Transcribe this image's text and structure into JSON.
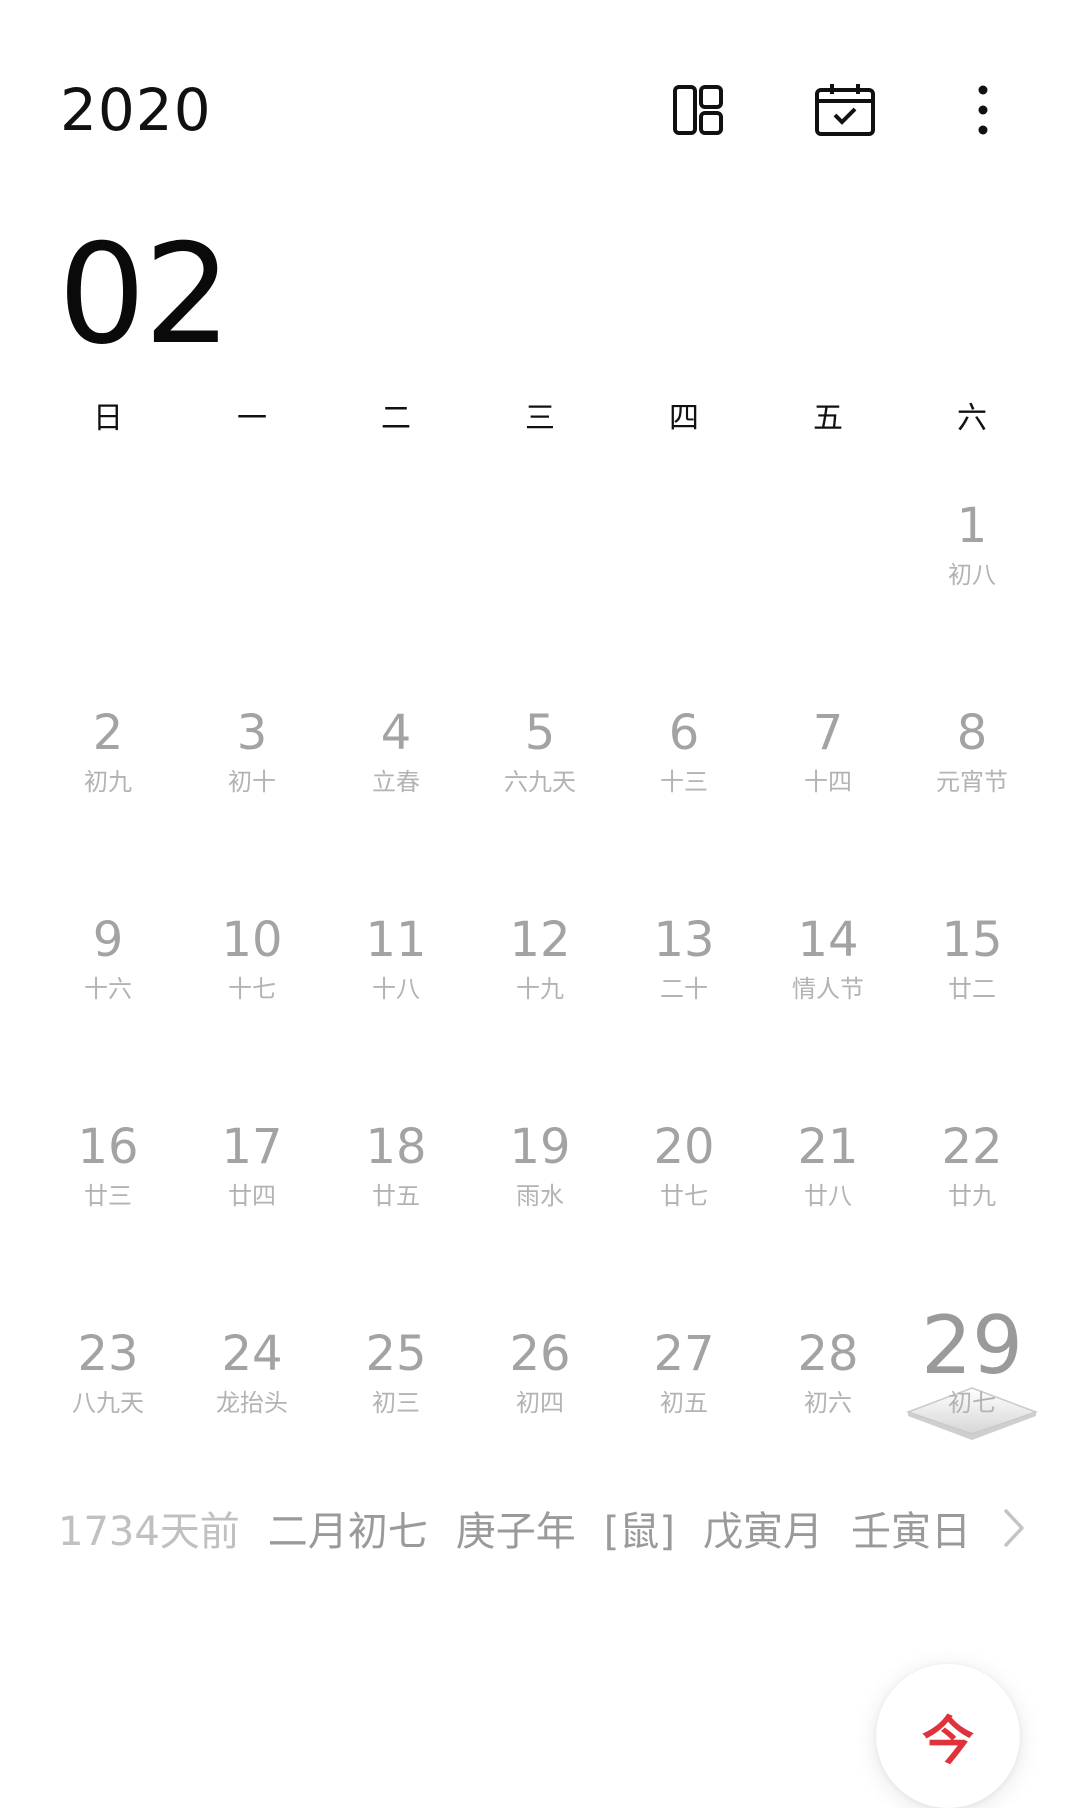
{
  "header": {
    "year": "2020",
    "month": "02",
    "icons": {
      "layout": "layout-panels-icon",
      "calendar": "calendar-check-icon",
      "more": "more-vertical-icon"
    }
  },
  "weekdays": [
    "日",
    "一",
    "二",
    "三",
    "四",
    "五",
    "六"
  ],
  "days": [
    {
      "day": "",
      "lunar": ""
    },
    {
      "day": "",
      "lunar": ""
    },
    {
      "day": "",
      "lunar": ""
    },
    {
      "day": "",
      "lunar": ""
    },
    {
      "day": "",
      "lunar": ""
    },
    {
      "day": "",
      "lunar": ""
    },
    {
      "day": "1",
      "lunar": "初八"
    },
    {
      "day": "2",
      "lunar": "初九"
    },
    {
      "day": "3",
      "lunar": "初十"
    },
    {
      "day": "4",
      "lunar": "立春"
    },
    {
      "day": "5",
      "lunar": "六九天"
    },
    {
      "day": "6",
      "lunar": "十三"
    },
    {
      "day": "7",
      "lunar": "十四"
    },
    {
      "day": "8",
      "lunar": "元宵节"
    },
    {
      "day": "9",
      "lunar": "十六"
    },
    {
      "day": "10",
      "lunar": "十七"
    },
    {
      "day": "11",
      "lunar": "十八"
    },
    {
      "day": "12",
      "lunar": "十九"
    },
    {
      "day": "13",
      "lunar": "二十"
    },
    {
      "day": "14",
      "lunar": "情人节"
    },
    {
      "day": "15",
      "lunar": "廿二"
    },
    {
      "day": "16",
      "lunar": "廿三"
    },
    {
      "day": "17",
      "lunar": "廿四"
    },
    {
      "day": "18",
      "lunar": "廿五"
    },
    {
      "day": "19",
      "lunar": "雨水"
    },
    {
      "day": "20",
      "lunar": "廿七"
    },
    {
      "day": "21",
      "lunar": "廿八"
    },
    {
      "day": "22",
      "lunar": "廿九"
    },
    {
      "day": "23",
      "lunar": "八九天"
    },
    {
      "day": "24",
      "lunar": "龙抬头"
    },
    {
      "day": "25",
      "lunar": "初三"
    },
    {
      "day": "26",
      "lunar": "初四"
    },
    {
      "day": "27",
      "lunar": "初五"
    },
    {
      "day": "28",
      "lunar": "初六"
    },
    {
      "day": "29",
      "lunar": "初七",
      "selected": true
    }
  ],
  "info": {
    "days_ago": "1734天前",
    "lunar_date": "二月初七",
    "year_ganzhi": "庚子年",
    "zodiac": "[鼠]",
    "month_ganzhi": "戊寅月",
    "day_ganzhi": "壬寅日"
  },
  "today_button": {
    "label": "今",
    "color": "#e0323a"
  },
  "colors": {
    "text_primary": "#111111",
    "day_number": "#a3a3a3",
    "lunar_text": "#b3b3b3",
    "accent": "#e0323a"
  }
}
